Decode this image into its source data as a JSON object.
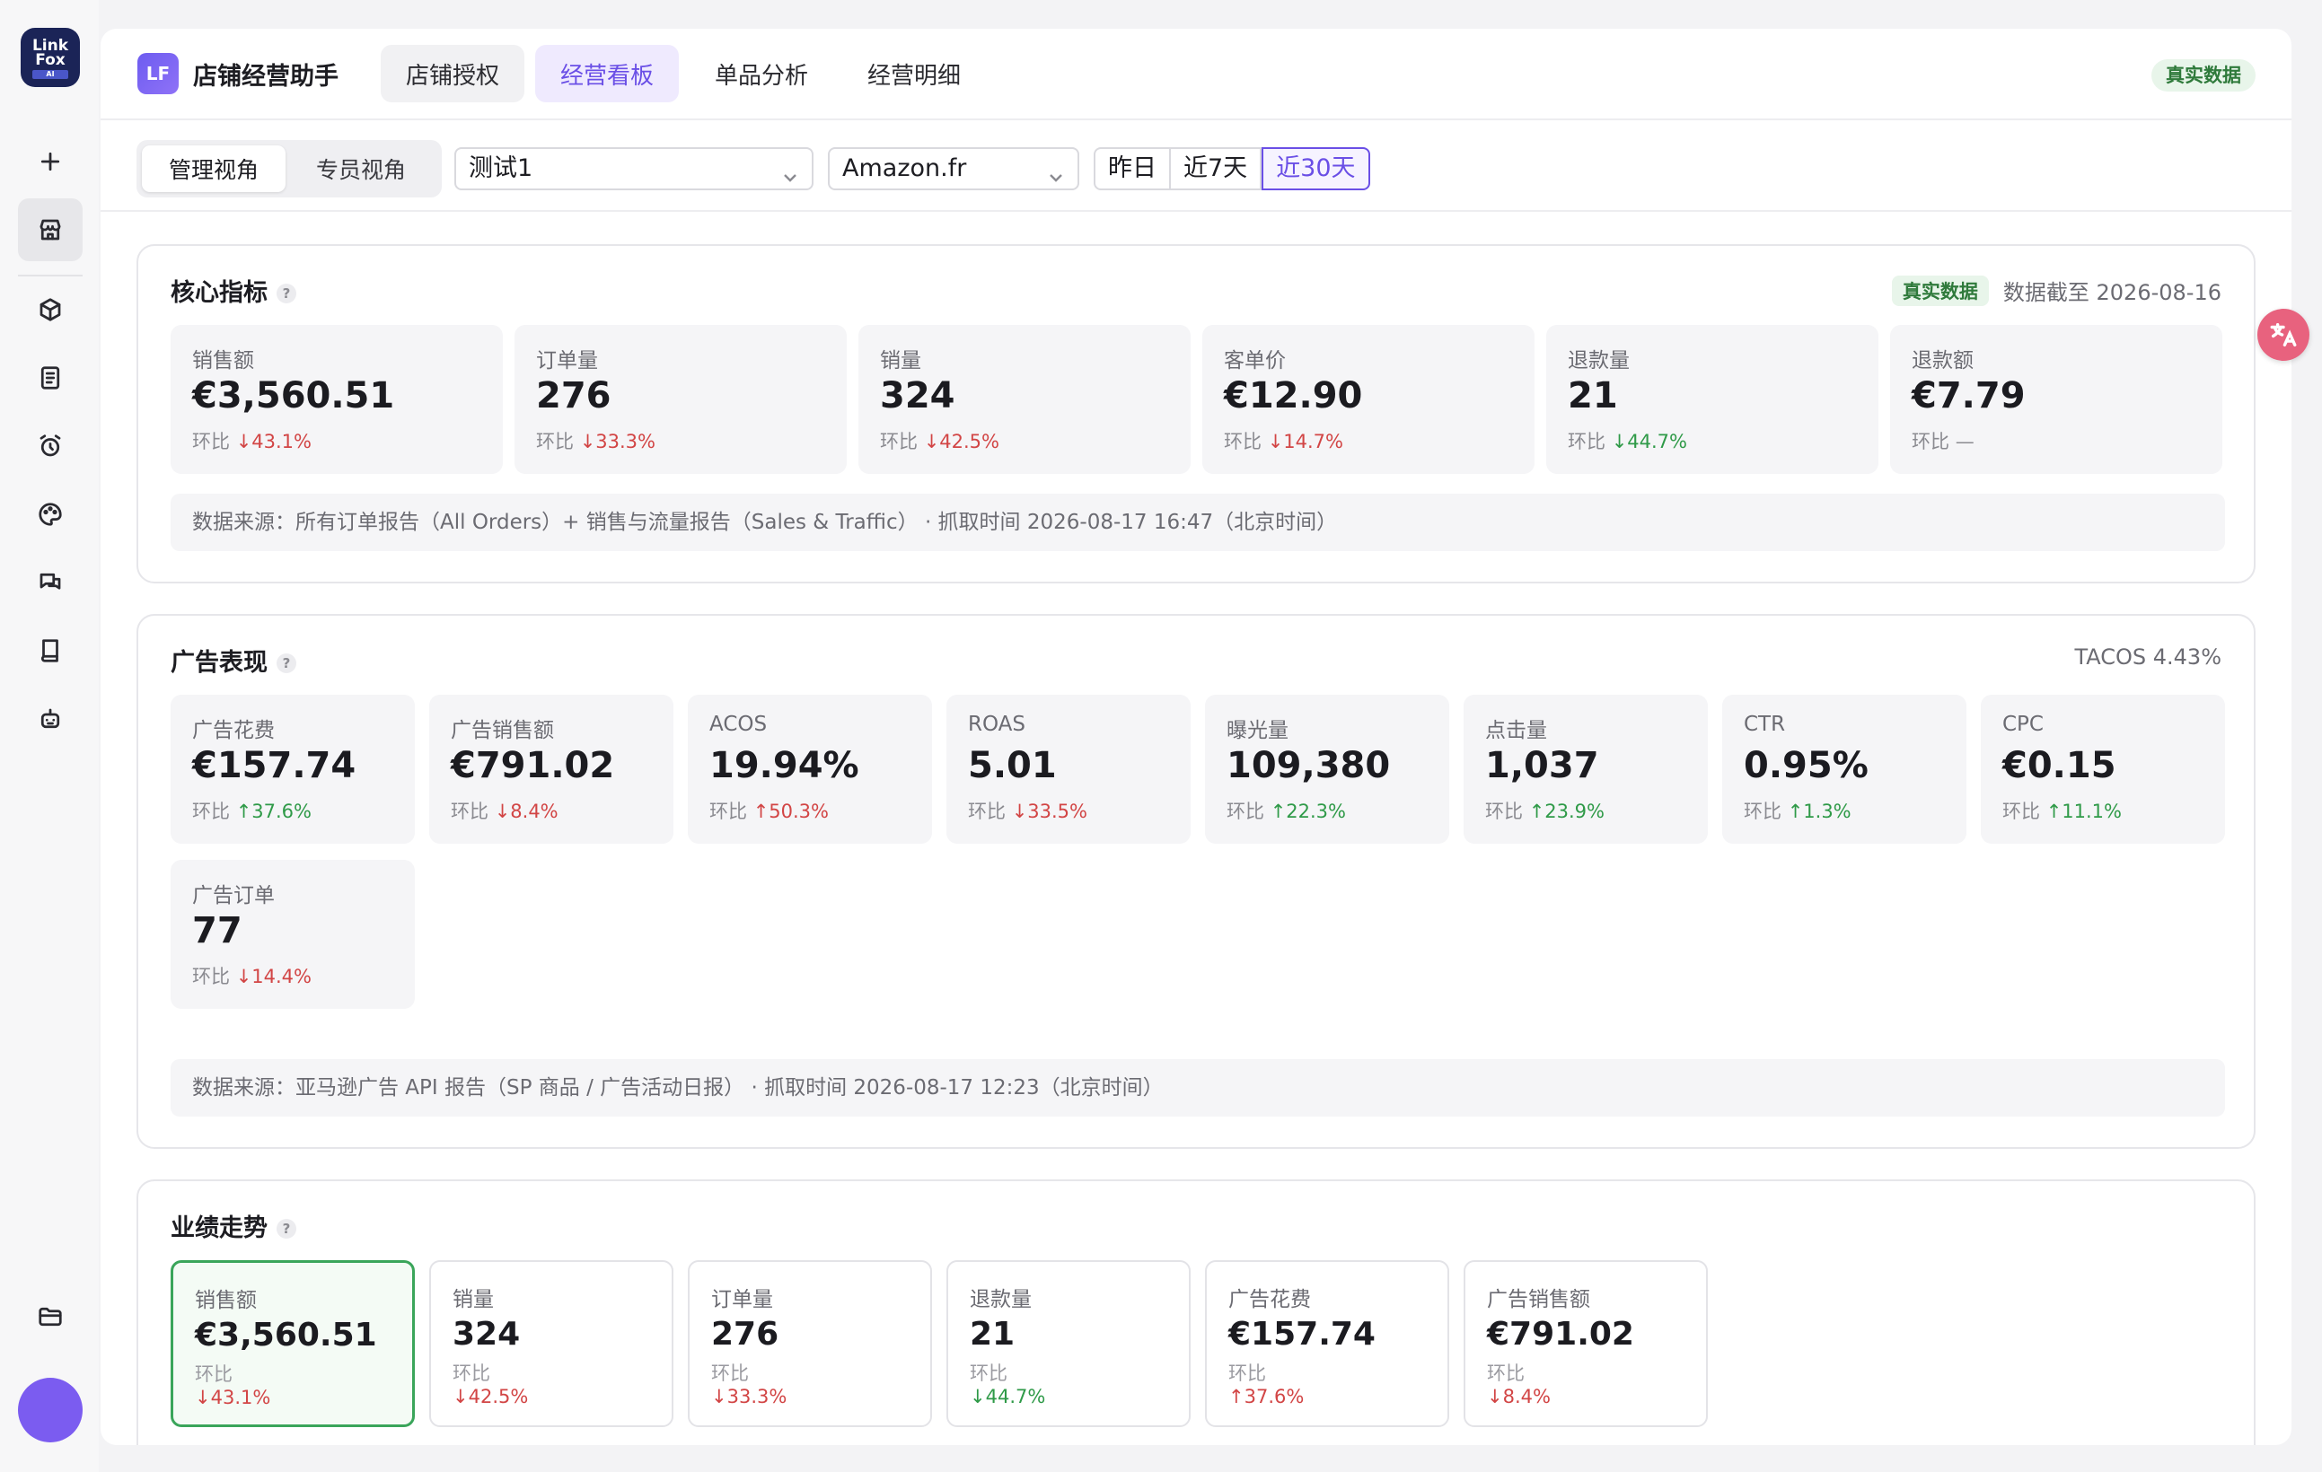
{
  "rail": {
    "logo_line1": "Link",
    "logo_line2": "Fox",
    "logo_ai": "AI",
    "icons": [
      "plus-icon",
      "store-icon",
      "box-icon",
      "document-icon",
      "alarm-icon",
      "palette-icon",
      "chat-icon",
      "book-icon",
      "robot-icon",
      "folder-icon"
    ]
  },
  "header": {
    "logo_text": "LF",
    "app_title": "店铺经营助手",
    "tabs": [
      "店铺授权",
      "经营看板",
      "单品分析",
      "经营明细"
    ],
    "active_tab": "经营看板",
    "badge": "真实数据"
  },
  "toolbar": {
    "views": [
      "管理视角",
      "专员视角"
    ],
    "store_select": "测试1",
    "market_select": "Amazon.fr",
    "ranges": [
      "昨日",
      "近7天",
      "近30天"
    ],
    "active_range": "近30天"
  },
  "core": {
    "title": "核心指标",
    "help": "?",
    "badge": "真实数据",
    "data_date": "数据截至 2026-08-16",
    "metrics": [
      {
        "label": "销售额",
        "value": "€3,560.51",
        "prefix": "环比",
        "change": "↓43.1%",
        "dir": "down"
      },
      {
        "label": "订单量",
        "value": "276",
        "prefix": "环比",
        "change": "↓33.3%",
        "dir": "down"
      },
      {
        "label": "销量",
        "value": "324",
        "prefix": "环比",
        "change": "↓42.5%",
        "dir": "down"
      },
      {
        "label": "客单价",
        "value": "€12.90",
        "prefix": "环比",
        "change": "↓14.7%",
        "dir": "down"
      },
      {
        "label": "退款量",
        "value": "21",
        "prefix": "环比",
        "change": "↓44.7%",
        "dir": "up"
      },
      {
        "label": "退款额",
        "value": "€7.79",
        "prefix": "环比",
        "change": "—",
        "dir": "none"
      }
    ],
    "source": "数据来源：所有订单报告（All Orders）+ 销售与流量报告（Sales & Traffic） · 抓取时间 2026-08-17 16:47（北京时间）"
  },
  "ads": {
    "title": "广告表现",
    "help": "?",
    "tacos": "TACOS 4.43%",
    "metrics": [
      {
        "label": "广告花费",
        "value": "€157.74",
        "prefix": "环比",
        "change": "↑37.6%",
        "dir": "up"
      },
      {
        "label": "广告销售额",
        "value": "€791.02",
        "prefix": "环比",
        "change": "↓8.4%",
        "dir": "down"
      },
      {
        "label": "ACOS",
        "value": "19.94%",
        "prefix": "环比",
        "change": "↑50.3%",
        "dir": "down"
      },
      {
        "label": "ROAS",
        "value": "5.01",
        "prefix": "环比",
        "change": "↓33.5%",
        "dir": "down"
      },
      {
        "label": "曝光量",
        "value": "109,380",
        "prefix": "环比",
        "change": "↑22.3%",
        "dir": "up"
      },
      {
        "label": "点击量",
        "value": "1,037",
        "prefix": "环比",
        "change": "↑23.9%",
        "dir": "up"
      },
      {
        "label": "CTR",
        "value": "0.95%",
        "prefix": "环比",
        "change": "↑1.3%",
        "dir": "up"
      },
      {
        "label": "CPC",
        "value": "€0.15",
        "prefix": "环比",
        "change": "↑11.1%",
        "dir": "up"
      },
      {
        "label": "广告订单",
        "value": "77",
        "prefix": "环比",
        "change": "↓14.4%",
        "dir": "down"
      }
    ],
    "source": "数据来源：亚马逊广告 API 报告（SP 商品 / 广告活动日报） · 抓取时间 2026-08-17 12:23（北京时间）"
  },
  "trend": {
    "title": "业绩走势",
    "help": "?",
    "cards": [
      {
        "label": "销售额",
        "value": "€3,560.51",
        "prefix": "环比",
        "change": "↓43.1%",
        "dir": "down"
      },
      {
        "label": "销量",
        "value": "324",
        "prefix": "环比",
        "change": "↓42.5%",
        "dir": "down"
      },
      {
        "label": "订单量",
        "value": "276",
        "prefix": "环比",
        "change": "↓33.3%",
        "dir": "down"
      },
      {
        "label": "退款量",
        "value": "21",
        "prefix": "环比",
        "change": "↓44.7%",
        "dir": "up"
      },
      {
        "label": "广告花费",
        "value": "€157.74",
        "prefix": "环比",
        "change": "↑37.6%",
        "dir": "down"
      },
      {
        "label": "广告销售额",
        "value": "€791.02",
        "prefix": "环比",
        "change": "↓8.4%",
        "dir": "down"
      }
    ],
    "selected": "销售额"
  },
  "colors": {
    "accent": "#6a4fe6",
    "down": "#d24545",
    "up": "#2f9a48",
    "selected_border": "#3aa55a"
  }
}
